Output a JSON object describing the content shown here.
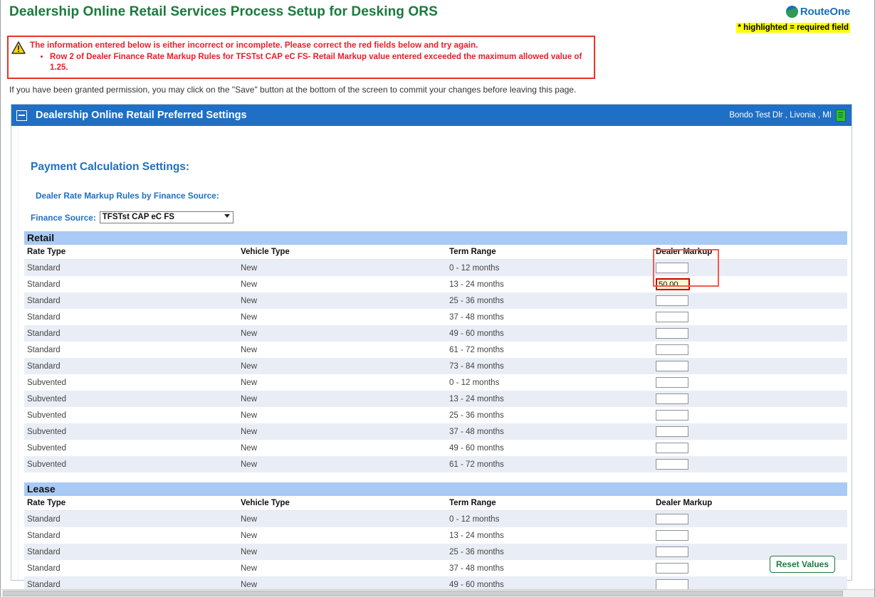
{
  "header": {
    "title": "Dealership Online Retail Services Process Setup for Desking ORS",
    "brand_name": "RouteOne",
    "required_note": "* highlighted = required field"
  },
  "error": {
    "icon": "warning-triangle-icon",
    "headline": "The information entered below is either incorrect or incomplete. Please correct the red fields below and try again.",
    "items": [
      "Row 2 of Dealer Finance Rate Markup Rules for TFSTst CAP eC FS- Retail Markup value entered exceeded the maximum allowed value of 1.25."
    ]
  },
  "permission_note": "If you have been granted permission, you may click on the \"Save\" button at the bottom of the screen to commit your changes before leaving this page.",
  "panel": {
    "title": "Dealership Online Retail Preferred Settings",
    "dealer": "Bondo Test Dlr , Livonia , MI",
    "collapse_icon": "minus-icon",
    "doc_icon": "document-icon"
  },
  "settings": {
    "section_title": "Payment Calculation Settings:",
    "sub_title": "Dealer Rate Markup Rules by Finance Source:",
    "finance_source_label": "Finance Source:",
    "finance_source_value": "TFSTst CAP eC FS",
    "finance_source_options": [
      "TFSTst CAP eC FS"
    ]
  },
  "columns": [
    "Rate Type",
    "Vehicle Type",
    "Term Range",
    "Dealer Markup"
  ],
  "retail": {
    "band_label": "Retail",
    "rows": [
      {
        "rate_type": "Standard",
        "vehicle_type": "New",
        "term_range": "0 - 12 months",
        "markup": "",
        "error": false
      },
      {
        "rate_type": "Standard",
        "vehicle_type": "New",
        "term_range": "13 - 24 months",
        "markup": "50.00",
        "error": true
      },
      {
        "rate_type": "Standard",
        "vehicle_type": "New",
        "term_range": "25 - 36 months",
        "markup": "",
        "error": false
      },
      {
        "rate_type": "Standard",
        "vehicle_type": "New",
        "term_range": "37 - 48 months",
        "markup": "",
        "error": false
      },
      {
        "rate_type": "Standard",
        "vehicle_type": "New",
        "term_range": "49 - 60 months",
        "markup": "",
        "error": false
      },
      {
        "rate_type": "Standard",
        "vehicle_type": "New",
        "term_range": "61 - 72 months",
        "markup": "",
        "error": false
      },
      {
        "rate_type": "Standard",
        "vehicle_type": "New",
        "term_range": "73 - 84 months",
        "markup": "",
        "error": false
      },
      {
        "rate_type": "Subvented",
        "vehicle_type": "New",
        "term_range": "0 - 12 months",
        "markup": "",
        "error": false
      },
      {
        "rate_type": "Subvented",
        "vehicle_type": "New",
        "term_range": "13 - 24 months",
        "markup": "",
        "error": false
      },
      {
        "rate_type": "Subvented",
        "vehicle_type": "New",
        "term_range": "25 - 36 months",
        "markup": "",
        "error": false
      },
      {
        "rate_type": "Subvented",
        "vehicle_type": "New",
        "term_range": "37 - 48 months",
        "markup": "",
        "error": false
      },
      {
        "rate_type": "Subvented",
        "vehicle_type": "New",
        "term_range": "49 - 60 months",
        "markup": "",
        "error": false
      },
      {
        "rate_type": "Subvented",
        "vehicle_type": "New",
        "term_range": "61 - 72 months",
        "markup": "",
        "error": false
      }
    ]
  },
  "lease": {
    "band_label": "Lease",
    "rows": [
      {
        "rate_type": "Standard",
        "vehicle_type": "New",
        "term_range": "0 - 12 months",
        "markup": "",
        "error": false
      },
      {
        "rate_type": "Standard",
        "vehicle_type": "New",
        "term_range": "13 - 24 months",
        "markup": "",
        "error": false
      },
      {
        "rate_type": "Standard",
        "vehicle_type": "New",
        "term_range": "25 - 36 months",
        "markup": "",
        "error": false
      },
      {
        "rate_type": "Standard",
        "vehicle_type": "New",
        "term_range": "37 - 48 months",
        "markup": "",
        "error": false
      },
      {
        "rate_type": "Standard",
        "vehicle_type": "New",
        "term_range": "49 - 60 months",
        "markup": "",
        "error": false
      }
    ]
  },
  "footer": {
    "reset_label": "Reset Values"
  },
  "colors": {
    "title_green": "#1a7a3c",
    "brand_blue": "#1f6fc4",
    "error_red": "#e8202a",
    "band_blue": "#a9caf5",
    "row_stripe": "#e9eef6",
    "highlight_yellow": "#ffff00"
  }
}
